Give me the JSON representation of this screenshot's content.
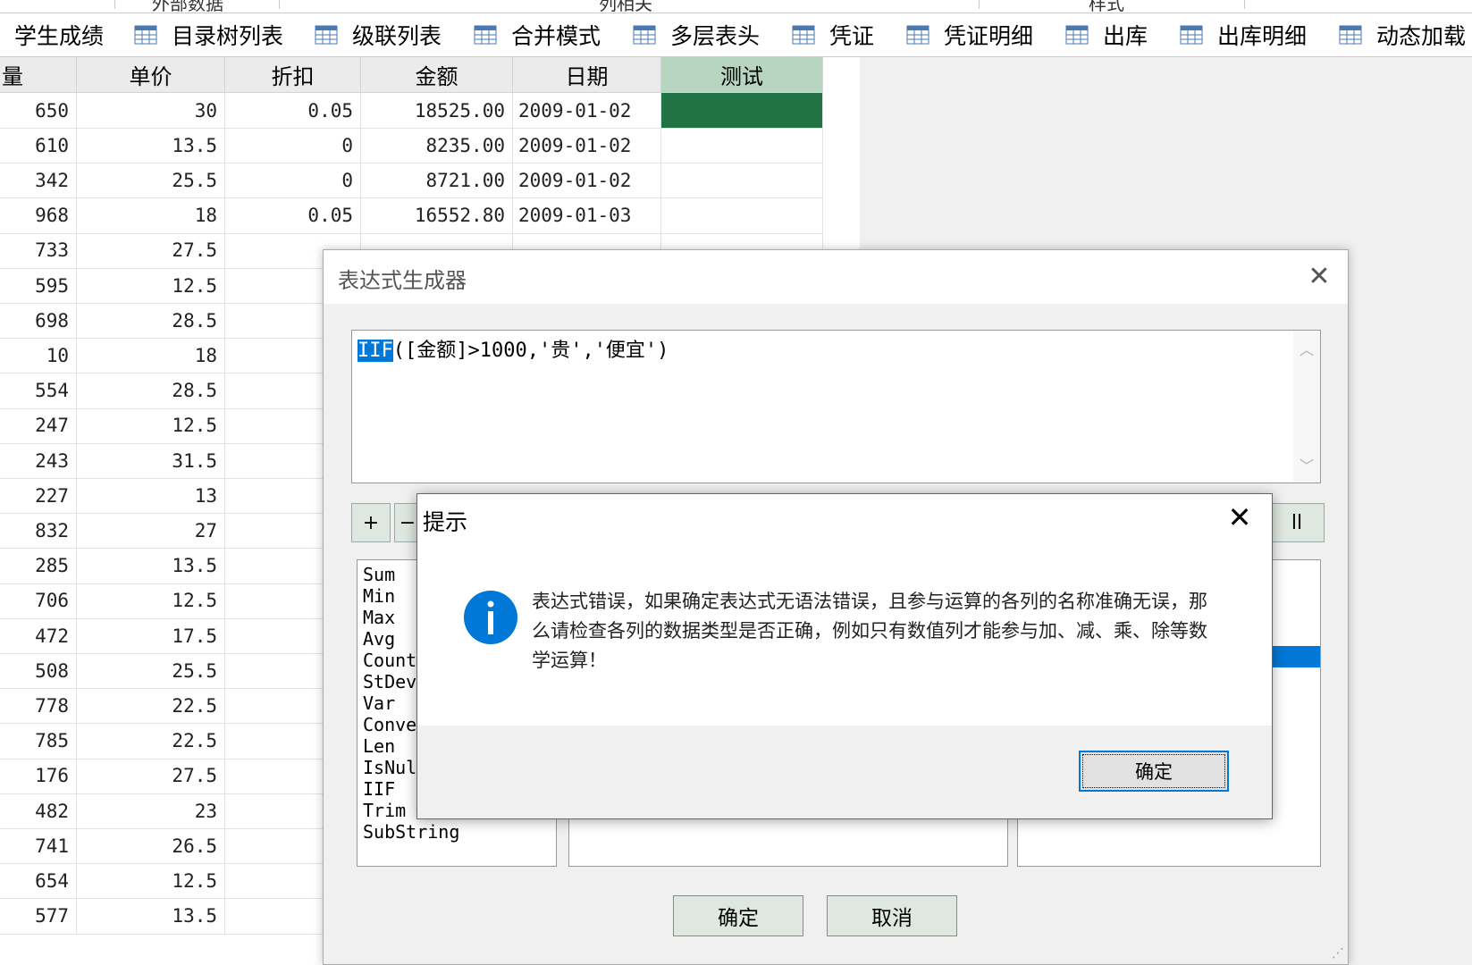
{
  "group_strip": [
    "外部数据",
    "列相关",
    "样式"
  ],
  "tabs": [
    "学生成绩",
    "目录树列表",
    "级联列表",
    "合并模式",
    "多层表头",
    "凭证",
    "凭证明细",
    "出库",
    "出库明细",
    "动态加载"
  ],
  "grid": {
    "headers": [
      "量",
      "单价",
      "折扣",
      "金额",
      "日期",
      "测试"
    ],
    "rows": [
      [
        "650",
        "30",
        "0.05",
        "18525.00",
        "2009-01-02"
      ],
      [
        "610",
        "13.5",
        "0",
        "8235.00",
        "2009-01-02"
      ],
      [
        "342",
        "25.5",
        "0",
        "8721.00",
        "2009-01-02"
      ],
      [
        "968",
        "18",
        "0.05",
        "16552.80",
        "2009-01-03"
      ],
      [
        "733",
        "27.5",
        "",
        "",
        ""
      ],
      [
        "595",
        "12.5",
        "",
        "",
        ""
      ],
      [
        "698",
        "28.5",
        "",
        "",
        ""
      ],
      [
        "10",
        "18",
        "",
        "",
        ""
      ],
      [
        "554",
        "28.5",
        "",
        "",
        ""
      ],
      [
        "247",
        "12.5",
        "",
        "",
        ""
      ],
      [
        "243",
        "31.5",
        "",
        "",
        ""
      ],
      [
        "227",
        "13",
        "",
        "",
        ""
      ],
      [
        "832",
        "27",
        "",
        "",
        ""
      ],
      [
        "285",
        "13.5",
        "",
        "",
        ""
      ],
      [
        "706",
        "12.5",
        "",
        "",
        ""
      ],
      [
        "472",
        "17.5",
        "",
        "",
        ""
      ],
      [
        "508",
        "25.5",
        "",
        "",
        ""
      ],
      [
        "778",
        "22.5",
        "",
        "",
        ""
      ],
      [
        "785",
        "22.5",
        "",
        "",
        ""
      ],
      [
        "176",
        "27.5",
        "",
        "",
        ""
      ],
      [
        "482",
        "23",
        "",
        "",
        ""
      ],
      [
        "741",
        "26.5",
        "",
        "",
        ""
      ],
      [
        "654",
        "12.5",
        "",
        "",
        ""
      ],
      [
        "577",
        "13.5",
        "",
        "",
        ""
      ]
    ],
    "highlight_color": "#217346",
    "selected_header_color": "#b7d5c0"
  },
  "expr_dialog": {
    "title": "表达式生成器",
    "close": "✕",
    "expression_keyword": "IIF",
    "expression_rest": "([金额]>1000,'贵','便宜')",
    "op_buttons": [
      "+",
      "−"
    ],
    "all_button_partial": "ll",
    "functions": [
      "Sum",
      "Min",
      "Max",
      "Avg",
      "Count",
      "StDev",
      "Var",
      "Convert",
      "Len",
      "IsNull",
      "IIF",
      "Trim",
      "SubString"
    ],
    "ok": "确定",
    "cancel": "取消"
  },
  "msgbox": {
    "title": "提示",
    "close": "✕",
    "icon": "info-icon",
    "message": "表达式错误，如果确定表达式无语法错误，且参与运算的各列的名称准确无误，那么请检查各列的数据类型是否正确，例如只有数值列才能参与加、减、乘、除等数学运算！",
    "ok": "确定",
    "accent": "#0078d7"
  }
}
